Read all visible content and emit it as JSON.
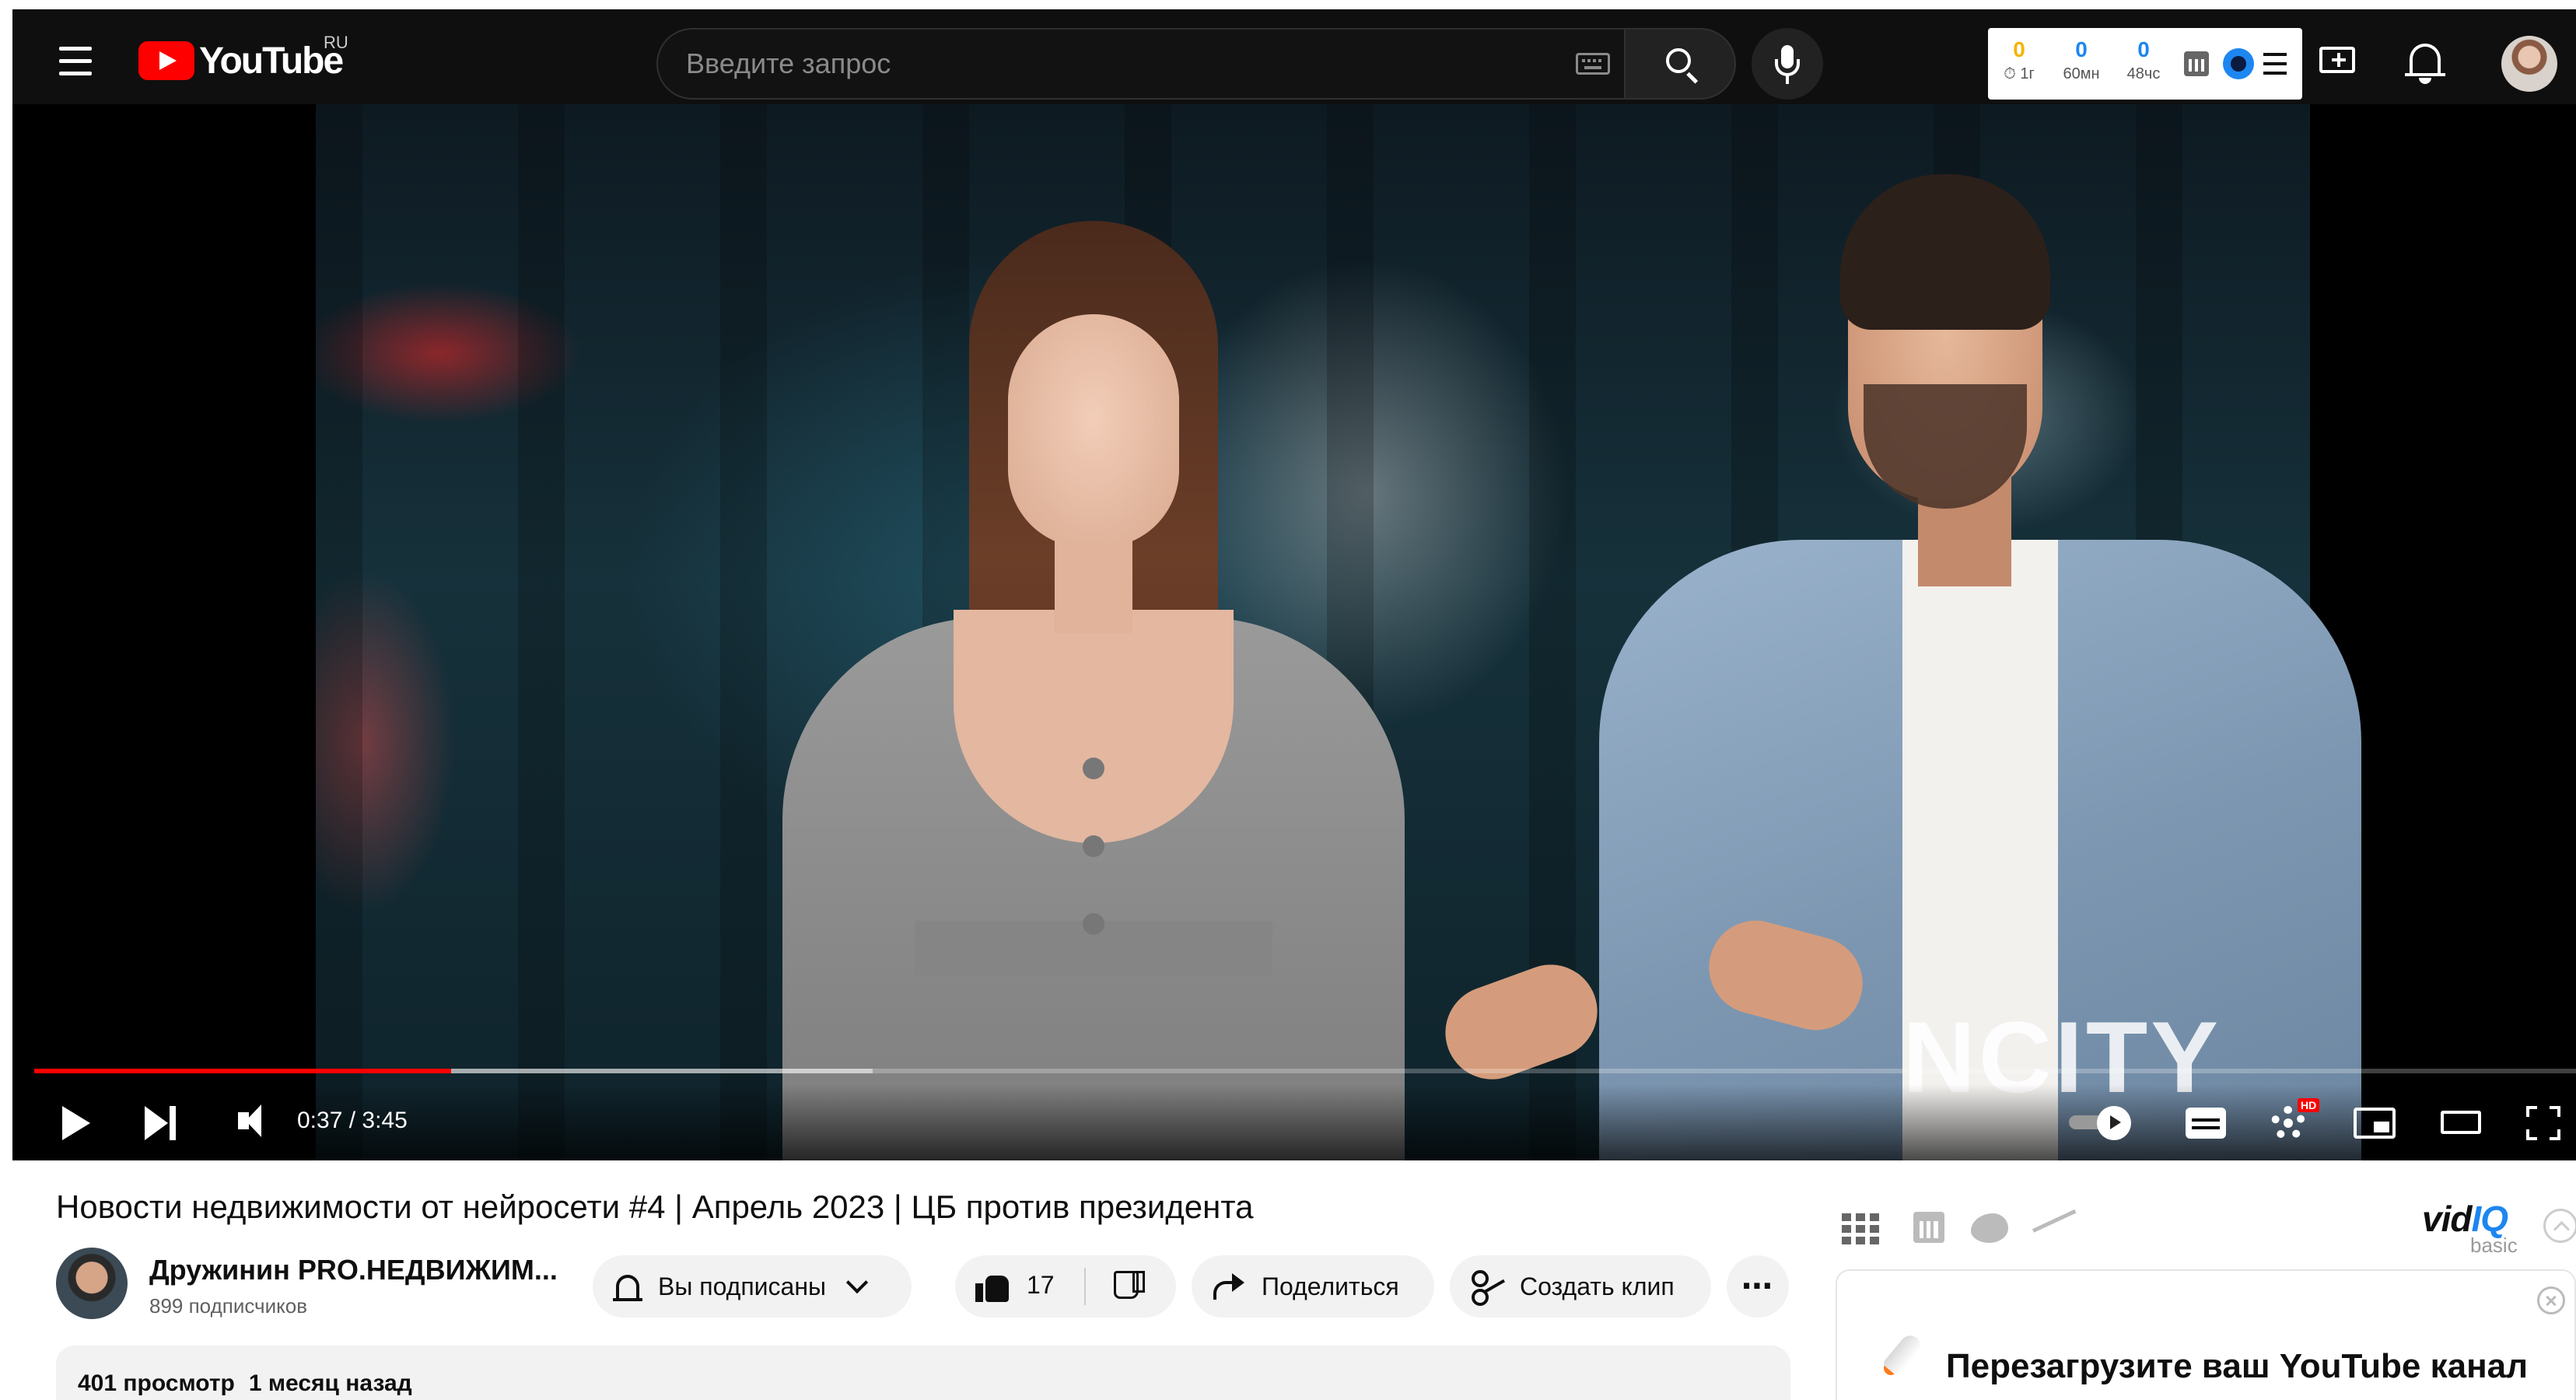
{
  "header": {
    "logo_text": "YouTube",
    "region": "RU",
    "search_placeholder": "Введите запрос"
  },
  "stats_widget": {
    "items": [
      {
        "value": "0",
        "label": "⏱ 1г",
        "color": "#f4b400"
      },
      {
        "value": "0",
        "label": "60мн",
        "color": "#1d86f0"
      },
      {
        "value": "0",
        "label": "48чс",
        "color": "#1d86f0"
      }
    ]
  },
  "video": {
    "watermark": "NCITY",
    "time": "0:37 / 3:45",
    "played_fraction": 0.164,
    "buffered_fraction": 0.33,
    "hd_badge": "HD",
    "progress_color": "#ff0000"
  },
  "info": {
    "title": "Новости недвижимости от нейросети #4 | Апрель 2023 | ЦБ против президента",
    "channel_name": "Дружинин PRO.НЕДВИЖИМ...",
    "subscribers": "899 подписчиков",
    "subscribe_label": "Вы подписаны",
    "like_count": "17",
    "share_label": "Поделиться",
    "clip_label": "Создать клип",
    "more_label": "⋯",
    "views": "401 просмотр",
    "date": "1 месяц назад"
  },
  "vidiq": {
    "logo_vid": "vid",
    "logo_iq": "IQ",
    "plan": "basic",
    "headline": "Перезагрузите ваш YouTube канал",
    "accent": "#1d86f0"
  }
}
